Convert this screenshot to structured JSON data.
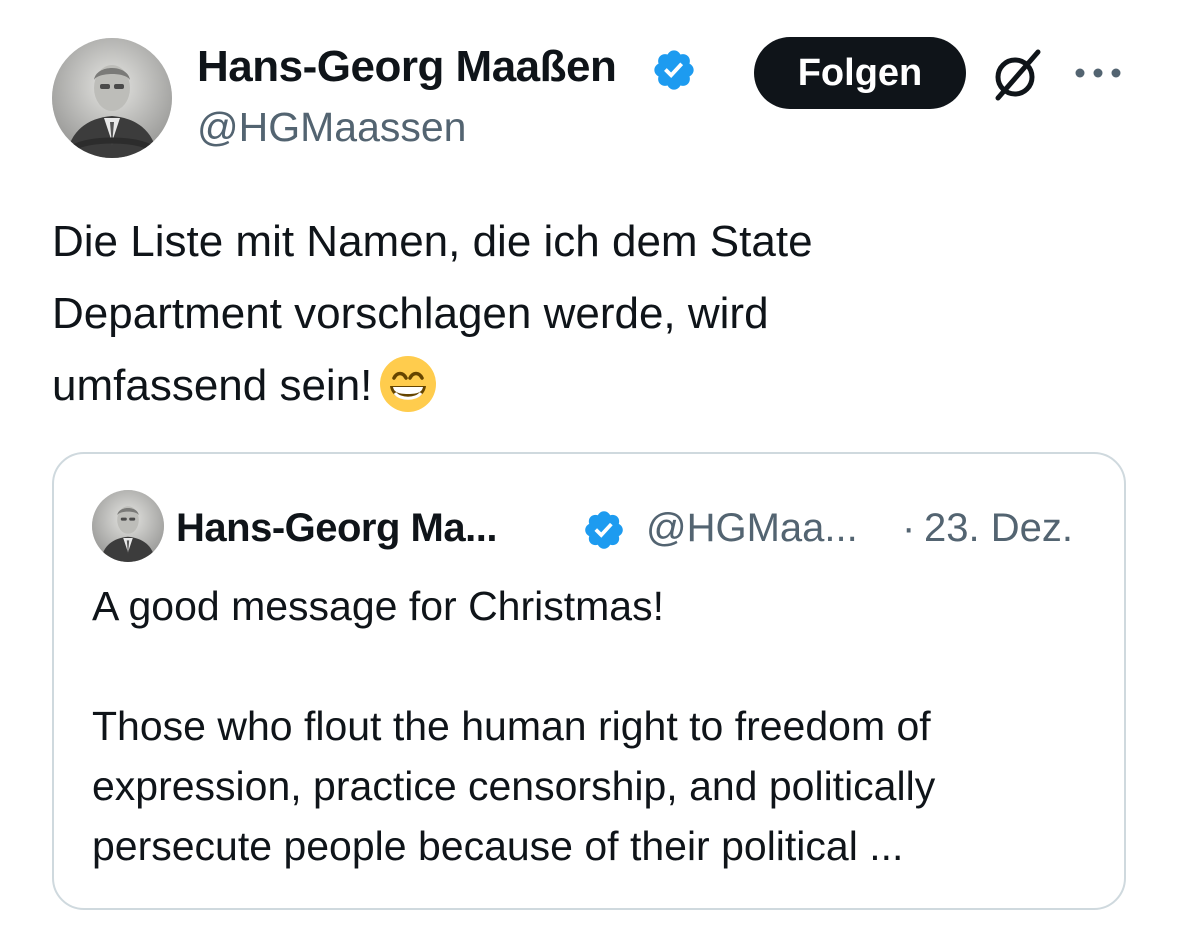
{
  "tweet": {
    "author_name": "Hans-Georg Maaßen",
    "author_handle": "@HGMaassen",
    "follow_label": "Folgen",
    "text_lines": [
      "Die Liste mit Namen, die ich dem State",
      "Department vorschlagen werde, wird",
      "umfassend sein!"
    ],
    "emoji": "grinning-face-with-smiling-eyes"
  },
  "quoted_tweet": {
    "author_name": "Hans-Georg Ma...",
    "author_handle": "@HGMaa...",
    "separator": "·",
    "date": "23. Dez.",
    "text_lines": [
      "A good message for Christmas!",
      "",
      "Those who flout the human right to freedom of",
      "expression, practice censorship, and politically",
      "persecute people because of their political ..."
    ]
  },
  "colors": {
    "text_primary": "#0f1419",
    "text_secondary": "#536471",
    "verified_blue": "#1d9bf0",
    "border": "#cfd9de",
    "button_bg": "#0f1419",
    "button_text": "#ffffff"
  },
  "icons": [
    "verified-badge-icon",
    "grok-icon",
    "more-options-icon",
    "grinning-emoji-icon"
  ]
}
